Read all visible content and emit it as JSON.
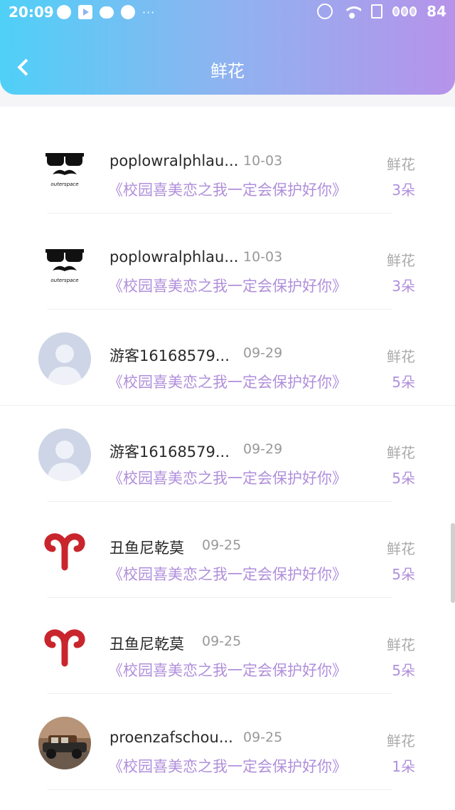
{
  "status_bar": {
    "time": "20:09",
    "battery": "84"
  },
  "header": {
    "title": "鲜花"
  },
  "colors": {
    "accent": "#b08fdb",
    "header_start": "#4fd0f7",
    "header_end": "#b693ea"
  },
  "items": [
    {
      "avatar": "sunglasses-mustache",
      "avatar_text": "outerspace",
      "name": "poplowralphlau...",
      "date": "10-03",
      "title": "《校园喜美恋之我一定会保护好你》",
      "gift": "鲜花",
      "count": "3朵"
    },
    {
      "avatar": "sunglasses-mustache",
      "avatar_text": "outerspace",
      "name": "poplowralphlau...",
      "date": "10-03",
      "title": "《校园喜美恋之我一定会保护好你》",
      "gift": "鲜花",
      "count": "3朵"
    },
    {
      "avatar": "default-person",
      "name": "游客16168579...",
      "date": "09-29",
      "title": "《校园喜美恋之我一定会保护好你》",
      "gift": "鲜花",
      "count": "5朵"
    },
    {
      "avatar": "default-person",
      "name": "游客16168579...",
      "date": "09-29",
      "title": "《校园喜美恋之我一定会保护好你》",
      "gift": "鲜花",
      "count": "5朵"
    },
    {
      "avatar": "aries-symbol",
      "name": "丑鱼尼乾莫",
      "date": "09-25",
      "title": "《校园喜美恋之我一定会保护好你》",
      "gift": "鲜花",
      "count": "5朵"
    },
    {
      "avatar": "aries-symbol",
      "name": "丑鱼尼乾莫",
      "date": "09-25",
      "title": "《校园喜美恋之我一定会保护好你》",
      "gift": "鲜花",
      "count": "5朵"
    },
    {
      "avatar": "vintage-car-photo",
      "name": "proenzafschou...",
      "date": "09-25",
      "title": "《校园喜美恋之我一定会保护好你》",
      "gift": "鲜花",
      "count": "1朵"
    }
  ]
}
